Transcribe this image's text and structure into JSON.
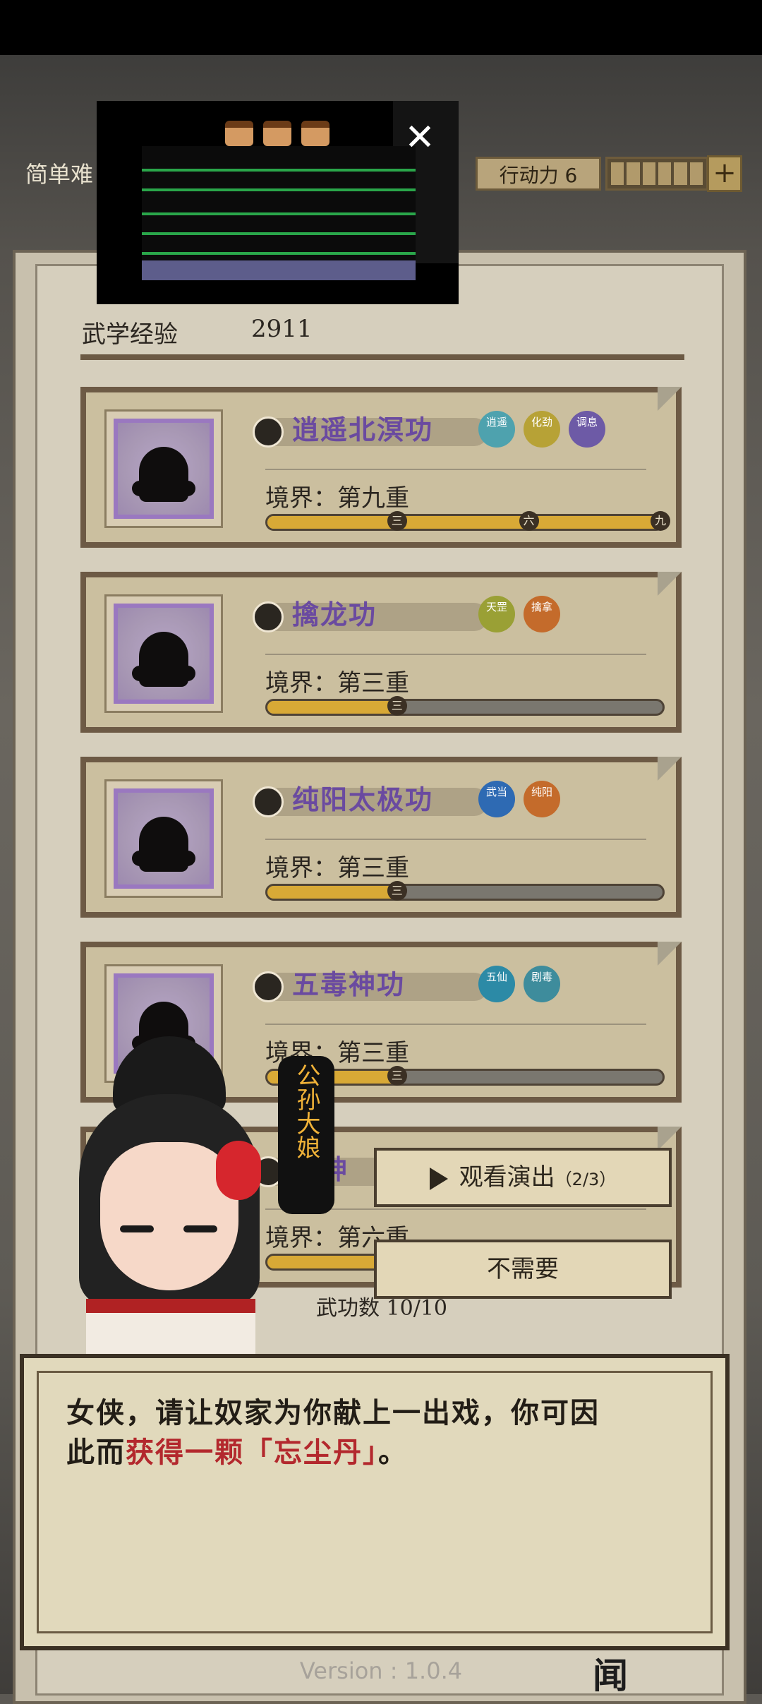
{
  "hud": {
    "difficulty": "简单难",
    "action_points": "行动力 6",
    "plus": "+"
  },
  "experience": {
    "label": "武学经验",
    "value": "2911"
  },
  "skills": [
    {
      "name": "逍遥北溟功",
      "realm": "境界：第九重",
      "progress": 1.0,
      "badges": [
        {
          "text": "逍遥",
          "color": "#4ea2ae"
        },
        {
          "text": "化劲",
          "color": "#b7a236"
        },
        {
          "text": "调息",
          "color": "#6d5aa6"
        }
      ],
      "ticks": [
        "三",
        "六",
        "九"
      ]
    },
    {
      "name": "擒龙功",
      "realm": "境界：第三重",
      "progress": 0.33,
      "badges": [
        {
          "text": "天罡",
          "color": "#9aa035"
        },
        {
          "text": "擒拿",
          "color": "#c46b2b"
        }
      ],
      "ticks": [
        "三"
      ]
    },
    {
      "name": "纯阳太极功",
      "realm": "境界：第三重",
      "progress": 0.33,
      "badges": [
        {
          "text": "武当",
          "color": "#2e6ab3"
        },
        {
          "text": "纯阳",
          "color": "#c46b2b"
        }
      ],
      "ticks": [
        "三"
      ]
    },
    {
      "name": "五毒神功",
      "realm": "境界：第三重",
      "progress": 0.33,
      "badges": [
        {
          "text": "五仙",
          "color": "#2c8aa6"
        },
        {
          "text": "剧毒",
          "color": "#3e8c9c"
        }
      ],
      "ticks": [
        "三"
      ]
    },
    {
      "name": "阳神",
      "realm": "境界：第六重",
      "progress": 0.6,
      "badges": [],
      "ticks": []
    }
  ],
  "skill_count": "武功数 10/10",
  "npc": {
    "name": "公孙大娘"
  },
  "options": {
    "watch": "观看演出",
    "watch_count": "（2/3）",
    "decline": "不需要"
  },
  "dialog": {
    "line1": "女侠，请让奴家为你献上一出戏，你可因",
    "line2_prefix": "此而",
    "line2_highlight": "获得一颗「忘尘丹」",
    "line2_suffix": "。"
  },
  "ad": {
    "close": "✕"
  },
  "version": "Version : 1.0.4",
  "corner": "闻"
}
